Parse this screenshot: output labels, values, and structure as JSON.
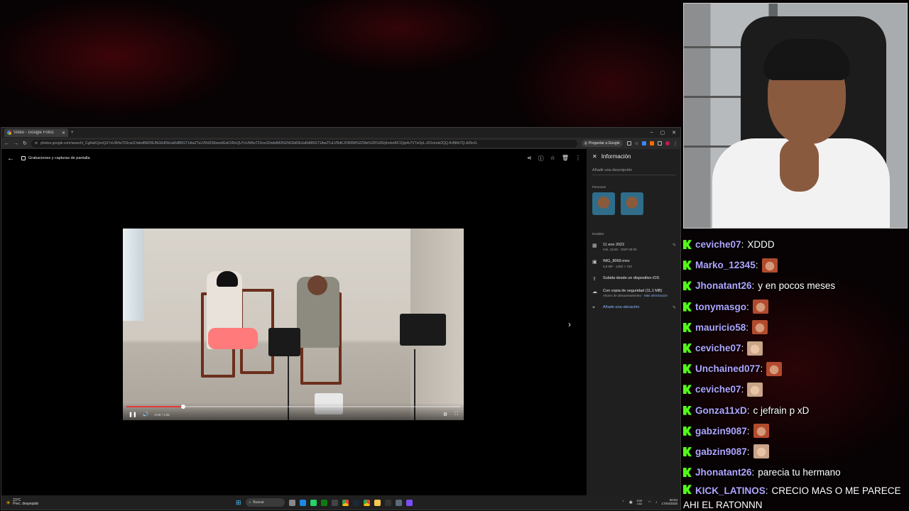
{
  "browser": {
    "tab_title": "Video - Google Fotos",
    "url": "photos.google.com/search/_CgAaKQovQUYxUWIwT23cw1Dwbd8M2NUNG6dDkUaRd8RGT1AwZTuLVRd2ISbwxdGsKXRnQUYxUWIwT23cw1DwbdM2NUNG6dDkUaRd8RGT1AwZTuLVRdKJORRM%2ZMe%3D%3D/photo/AF1Qip4v7VTuOpL-i2Ozmdx2QQ-KrB8lnTQ-AZbvG",
    "ask_google": "Preguntar a Google"
  },
  "viewer": {
    "album_chip": "Grabaciones y capturas de pantalla",
    "time": "0:00 / 1:05",
    "progress": 0.17
  },
  "info": {
    "title": "Información",
    "description_placeholder": "Añadir una descripción",
    "people_label": "Personas",
    "details_label": "Detalles",
    "date": "11 ene 2022",
    "date_sub": "mié, 15:50 · GMT-05:00",
    "filename": "IMG_8069.mov",
    "file_sub": "0,9 MP · 1280 × 720",
    "upload": "Subida desde un dispositivo iOS",
    "backup": "Con copia de seguridad (11,1 MB)",
    "backup_sub": "Ahorro de almacenamiento ·",
    "more_info": "Más información",
    "add_location": "Añade una ubicación"
  },
  "taskbar": {
    "temperature": "23°C",
    "weather_text": "Prec. despejado",
    "search": "Buscar",
    "lang": "ESP LAA",
    "time": "00:54",
    "date": "17/04/2025"
  },
  "chat": [
    {
      "user": "ceviche07",
      "text": "XDDD",
      "emote": false
    },
    {
      "user": "Marko_12345",
      "text": "",
      "emote": true
    },
    {
      "user": "Jhonatant26",
      "text": "y en pocos meses",
      "emote": false
    },
    {
      "user": "tonymasgo",
      "text": "",
      "emote": true
    },
    {
      "user": "mauricio58",
      "text": "",
      "emote": true
    },
    {
      "user": "ceviche07",
      "text": "",
      "emote": true,
      "light": true
    },
    {
      "user": "Unchained077",
      "text": "",
      "emote": true
    },
    {
      "user": "ceviche07",
      "text": "",
      "emote": true,
      "light": true
    },
    {
      "user": "Gonza11xD",
      "text": "c jefrain p xD",
      "emote": false
    },
    {
      "user": "gabzin9087",
      "text": "",
      "emote": true
    },
    {
      "user": "gabzin9087",
      "text": "",
      "emote": true,
      "light": true
    },
    {
      "user": "Jhonatant26",
      "text": "parecia tu hermano",
      "emote": false
    },
    {
      "user": "KICK_LATINOS",
      "text": "CRECIO MAS O ME PARECE AHI EL RATONNN",
      "emote": false
    }
  ],
  "colors": {
    "accent_red": "#e53935",
    "kick_green": "#53fc18",
    "username": "#b0a6ff"
  }
}
